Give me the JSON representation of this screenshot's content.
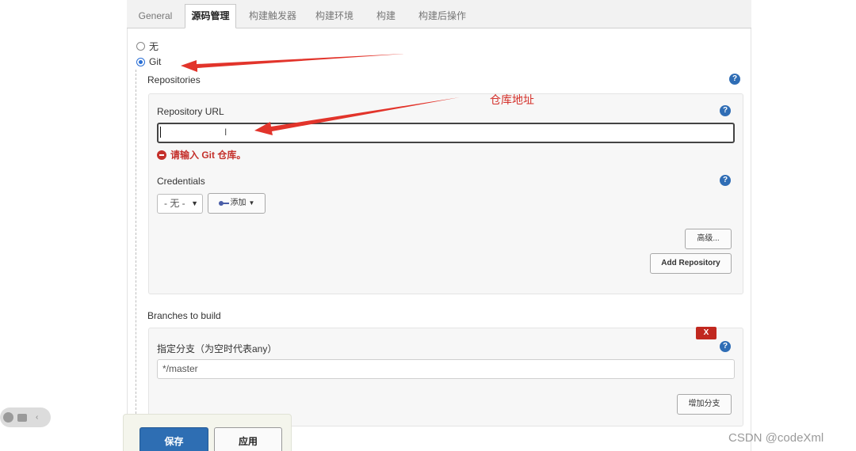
{
  "tabs": [
    {
      "label": "General",
      "active": false
    },
    {
      "label": "源码管理",
      "active": true
    },
    {
      "label": "构建触发器",
      "active": false
    },
    {
      "label": "构建环境",
      "active": false
    },
    {
      "label": "构建",
      "active": false
    },
    {
      "label": "构建后操作",
      "active": false
    }
  ],
  "scm": {
    "option_none": "无",
    "option_git": "Git",
    "selected": "Git"
  },
  "repositories": {
    "title": "Repositories",
    "url_label": "Repository URL",
    "url_value": "",
    "error": "请输入 Git 仓库。",
    "credentials_label": "Credentials",
    "credentials_selected": "- 无 -",
    "add_label": "添加",
    "advanced_label": "高级...",
    "add_repository_label": "Add Repository"
  },
  "branches": {
    "title": "Branches to build",
    "spec_label": "指定分支（为空时代表any）",
    "spec_value": "*/master",
    "delete_label": "X",
    "add_branch_label": "增加分支"
  },
  "footer": {
    "save_label": "保存",
    "apply_label": "应用"
  },
  "annotation": {
    "text": "仓库地址",
    "color": "#d4302a"
  },
  "help_glyph": "?",
  "watermark": "CSDN @codeXml",
  "colors": {
    "primary": "#2e6eb3",
    "error": "#c4302b",
    "help": "#2f6db5"
  }
}
